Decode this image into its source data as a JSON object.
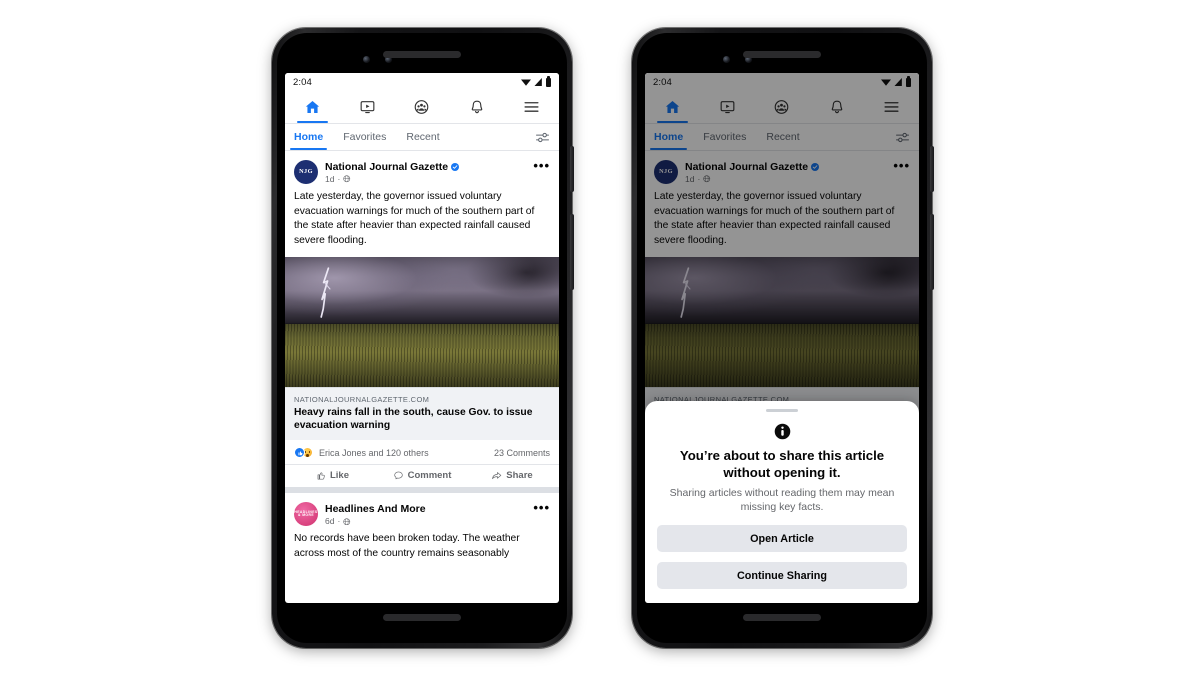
{
  "status_bar": {
    "time": "2:04",
    "wifi_icon": "wifi-icon",
    "signal_icon": "cell-signal-icon",
    "battery_icon": "battery-icon"
  },
  "top_nav": [
    {
      "name": "home",
      "icon": "home-icon",
      "active": true
    },
    {
      "name": "watch",
      "icon": "video-icon",
      "active": false
    },
    {
      "name": "groups",
      "icon": "groups-icon",
      "active": false
    },
    {
      "name": "notifications",
      "icon": "bell-icon",
      "active": false
    },
    {
      "name": "menu",
      "icon": "hamburger-menu-icon",
      "active": false
    }
  ],
  "tabs": {
    "items": [
      {
        "label": "Home",
        "active": true
      },
      {
        "label": "Favorites",
        "active": false
      },
      {
        "label": "Recent",
        "active": false
      }
    ],
    "filter_icon": "sliders-filter-icon"
  },
  "post": {
    "avatar_initials": "NJG",
    "author": "National Journal Gazette",
    "verified_icon": "verified-badge-icon",
    "timestamp": "1d",
    "privacy_icon": "globe-icon",
    "separator": "·",
    "more_options": "•••",
    "body": "Late yesterday, the governor issued voluntary evacuation warnings for much of the southern part of the state after heavier than expected rainfall caused severe flooding.",
    "photo_alt": "lightning-storm-over-field-photo",
    "link_domain": "NATIONALJOURNALGAZETTE.COM",
    "link_title": "Heavy rains fall in the south, cause Gov. to issue evacuation warning",
    "reactions_text": "Erica Jones and 120 others",
    "comments_text": "23 Comments",
    "actions": [
      {
        "label": "Like",
        "icon": "thumbs-up-icon"
      },
      {
        "label": "Comment",
        "icon": "comment-bubble-icon"
      },
      {
        "label": "Share",
        "icon": "share-arrow-icon"
      }
    ]
  },
  "post2": {
    "avatar_initials": "HEADLINES & MORE",
    "author": "Headlines And More",
    "timestamp": "6d",
    "privacy_icon": "globe-icon",
    "separator": "·",
    "more_options": "•••",
    "body": "No records have been broken today. The weather across most of the country remains seasonably"
  },
  "dialog": {
    "info_icon": "info-circle-icon",
    "title": "You’re about to share this article without opening it.",
    "subtitle": "Sharing articles without reading them may mean missing key facts.",
    "primary_label": "Open Article",
    "secondary_label": "Continue Sharing"
  },
  "colors": {
    "brand_blue": "#1877f2",
    "text_primary": "#050505",
    "text_secondary": "#65676b",
    "card_gray": "#f0f2f5",
    "button_gray": "#e4e6eb",
    "avatar_navy": "#1d2f72",
    "avatar_pink": "#d9427e"
  }
}
